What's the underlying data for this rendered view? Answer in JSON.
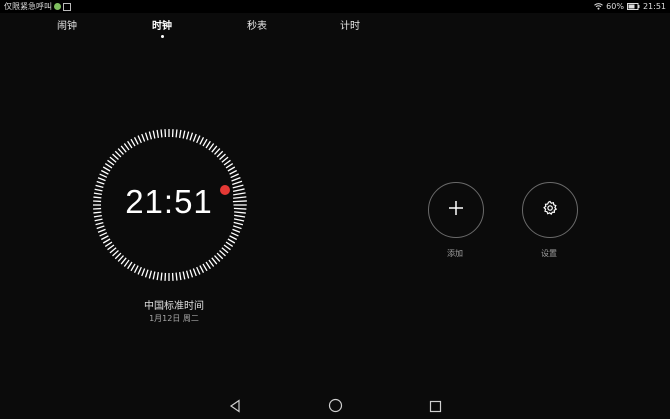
{
  "status_bar": {
    "left_text": "仅限紧急呼叫",
    "battery": "60%",
    "time": "21:51"
  },
  "tabs": [
    {
      "label": "闹钟",
      "active": false
    },
    {
      "label": "时钟",
      "active": true
    },
    {
      "label": "秒表",
      "active": false
    },
    {
      "label": "计时",
      "active": false
    }
  ],
  "clock": {
    "time": "21:51",
    "city": "中国标准时间",
    "date": "1月12日 周二"
  },
  "actions": {
    "add_label": "添加",
    "settings_label": "设置"
  },
  "nav": {
    "back_icon": "back-triangle-icon",
    "home_icon": "home-circle-icon",
    "recents_icon": "recents-square-icon"
  },
  "colors": {
    "background": "#0b0b0b",
    "accent_red": "#e53935",
    "text": "#ffffff",
    "muted": "#a0a0a0"
  }
}
